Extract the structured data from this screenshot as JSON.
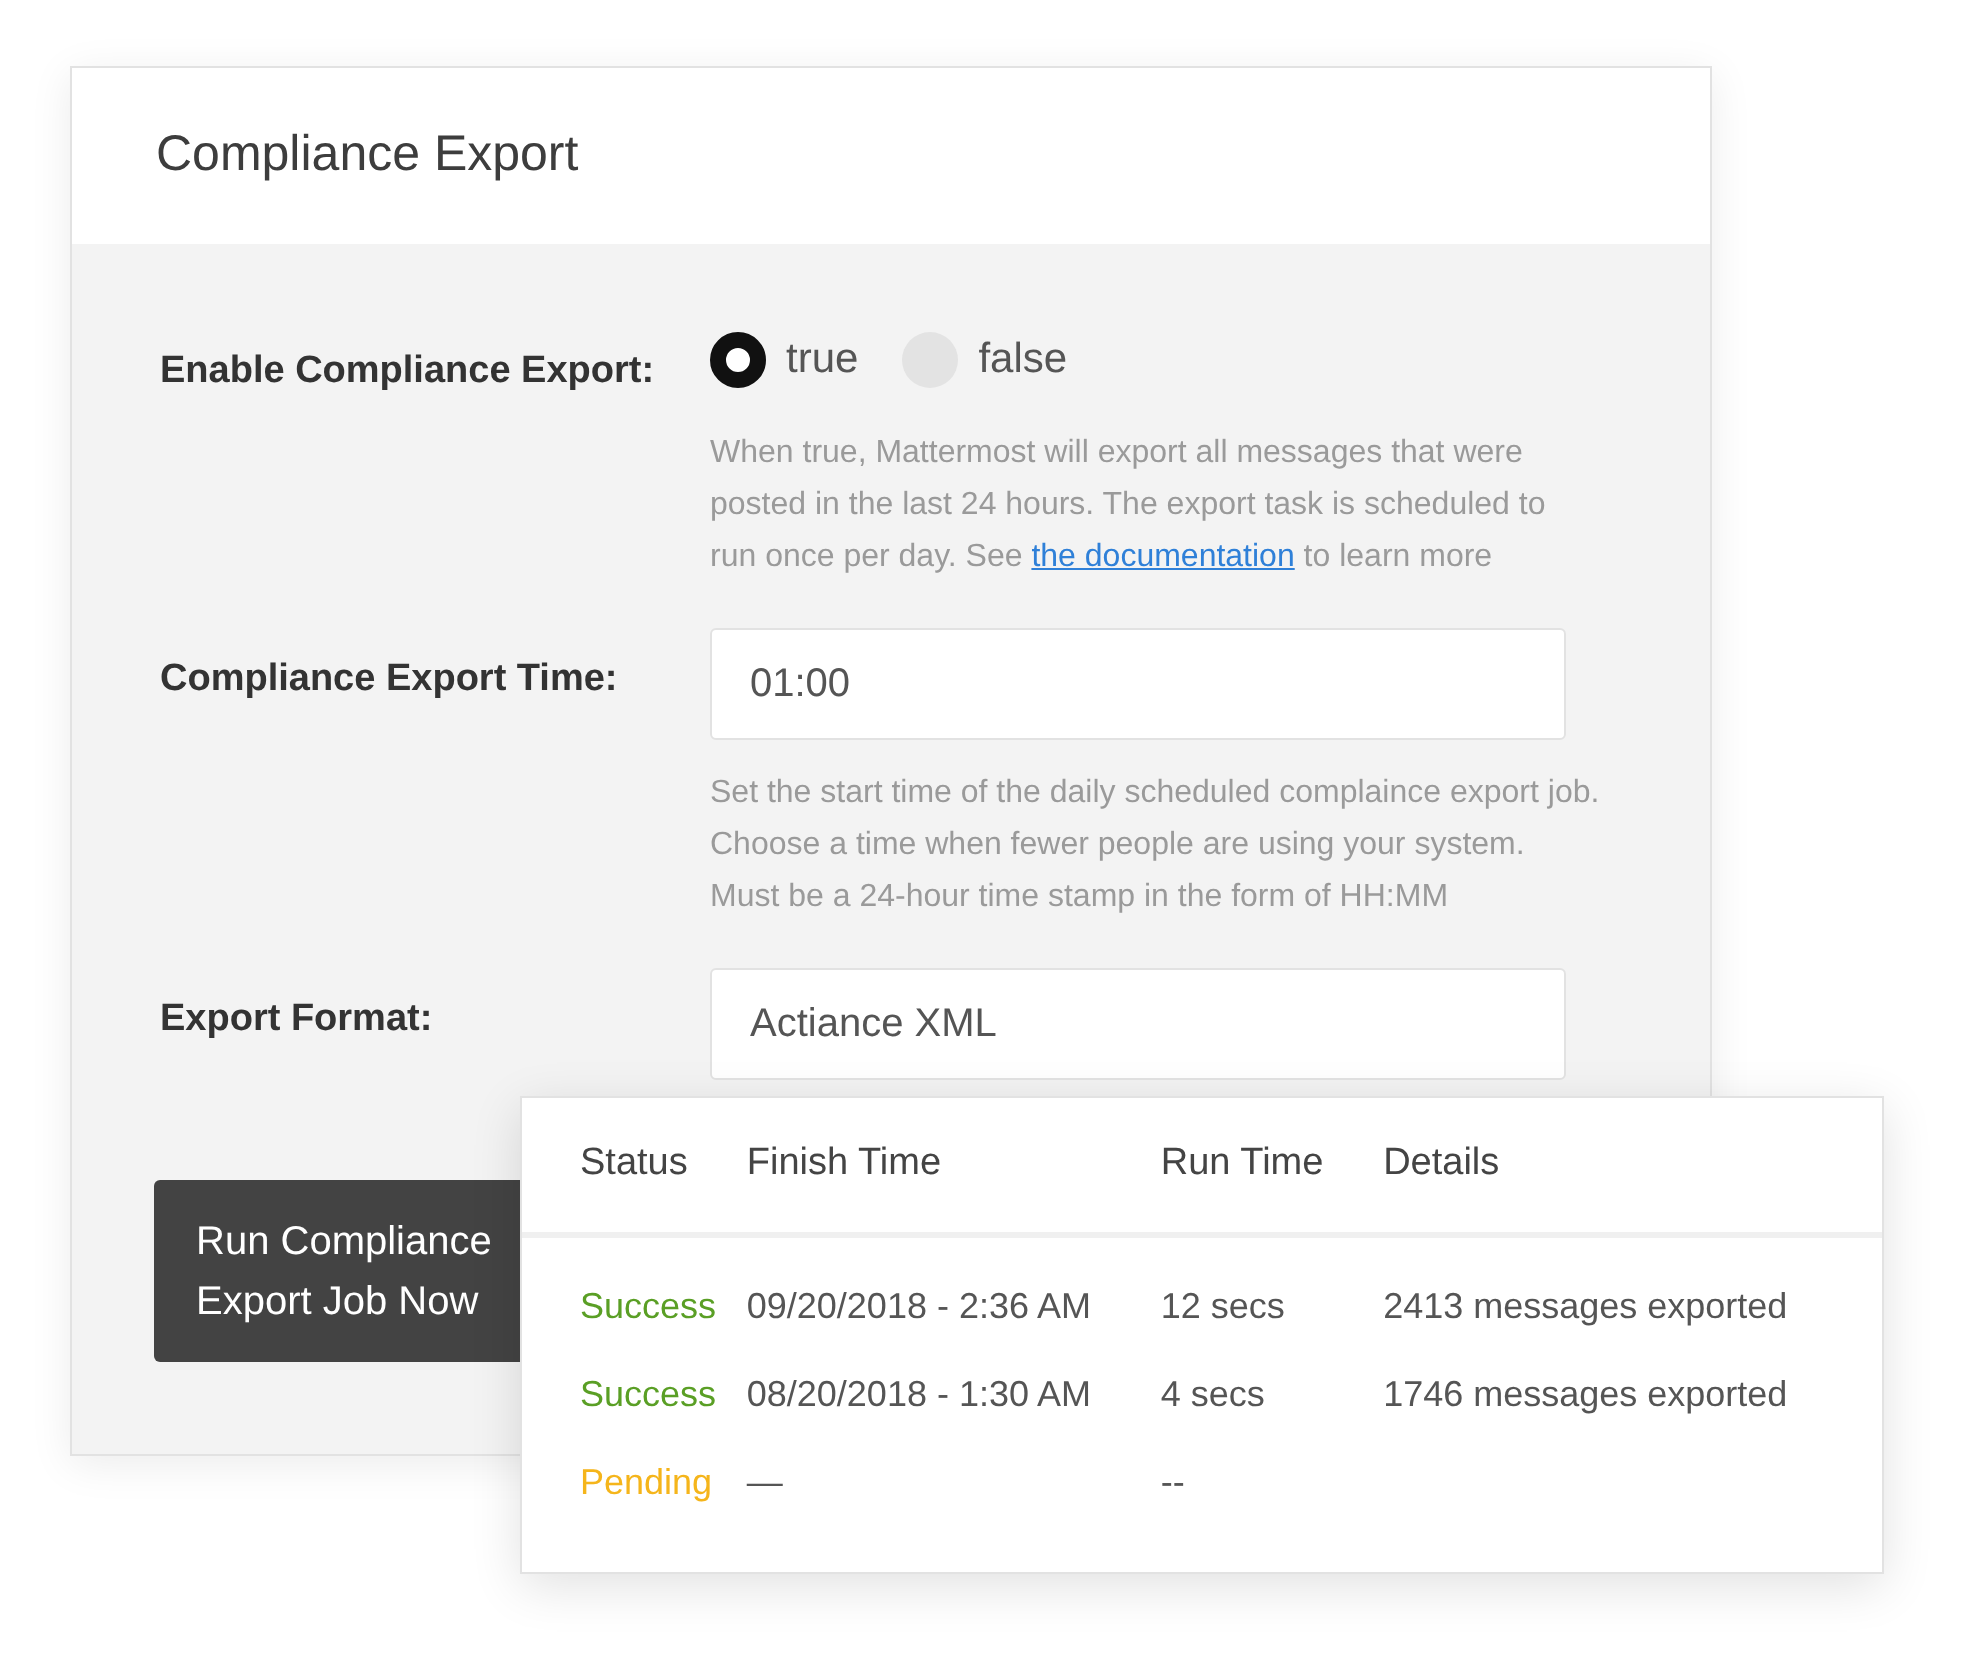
{
  "panel": {
    "title": "Compliance Export"
  },
  "settings": [
    {
      "kind": "radio",
      "label": "Enable Compliance Export:",
      "options": [
        {
          "label": "true",
          "selected": true
        },
        {
          "label": "false",
          "selected": false
        }
      ],
      "help": {
        "before": "When true, Mattermost will export all messages that were posted in the last 24 hours. The export task is scheduled to run once per day. See ",
        "link": "the documentation",
        "after": " to learn more"
      }
    },
    {
      "kind": "input",
      "label": "Compliance Export Time:",
      "value": "01:00",
      "help": {
        "before": "Set the start time of the daily scheduled complaince export job. Choose a time when fewer people are using your system. Must be a 24-hour time stamp in the form of HH:MM"
      }
    },
    {
      "kind": "input",
      "label": "Export Format:",
      "value": "Actiance XML"
    }
  ],
  "run_button": {
    "label": "Run Compliance Export Job Now"
  },
  "jobs_table": {
    "columns": [
      "Status",
      "Finish Time",
      "Run Time",
      "Details"
    ],
    "rows": [
      {
        "status": {
          "text": "Success",
          "kind": "success"
        },
        "finish": "09/20/2018 - 2:36 AM",
        "run": "12 secs",
        "details": "2413 messages exported"
      },
      {
        "status": {
          "text": "Success",
          "kind": "success"
        },
        "finish": "08/20/2018 - 1:30 AM",
        "run": "4 secs",
        "details": "1746 messages exported"
      },
      {
        "status": {
          "text": "Pending",
          "kind": "pending"
        },
        "finish": "—",
        "run": "--"
      }
    ]
  }
}
